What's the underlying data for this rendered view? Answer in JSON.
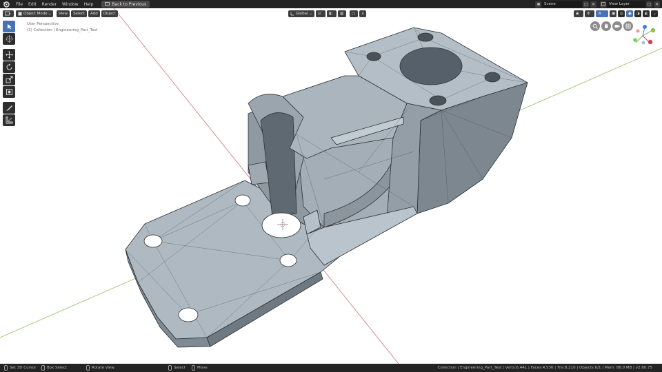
{
  "menubar": {
    "items": [
      "File",
      "Edit",
      "Render",
      "Window",
      "Help"
    ],
    "back_button": "Back to Previous",
    "scene_name": "Scene",
    "view_layer": "View Layer"
  },
  "header": {
    "mode": "Object Mode",
    "menus": [
      "View",
      "Select",
      "Add",
      "Object"
    ],
    "orientation": "Global"
  },
  "viewport": {
    "view_name": "User Perspective",
    "collection_path": "(1) Collection | Engineering_Part_Test"
  },
  "statusbar": {
    "left_click": "Set 3D Cursor",
    "box_select": "Box Select",
    "rotate_view": "Rotate View",
    "select": "Select",
    "move": "Move",
    "stats": "Collection | Engineering_Part_Test | Verts:6,441 | Faces:4,536 | Tris:8,210 | Objects:0/1 | Mem: 86.0 MB | v2.80.75"
  },
  "colors": {
    "active_tool": "#4772b3",
    "x_axis": "#d05a66",
    "y_axis": "#7fb24a",
    "z_axis": "#3f7fe0",
    "mesh_fill": "#a9b6bf"
  },
  "icons": [
    "blender-logo-icon",
    "cursor-icon",
    "move-icon",
    "rotate-icon",
    "scale-icon",
    "transform-icon",
    "annotate-icon",
    "measure-icon",
    "zoom-icon",
    "hand-icon",
    "camera-icon",
    "grid-icon"
  ]
}
